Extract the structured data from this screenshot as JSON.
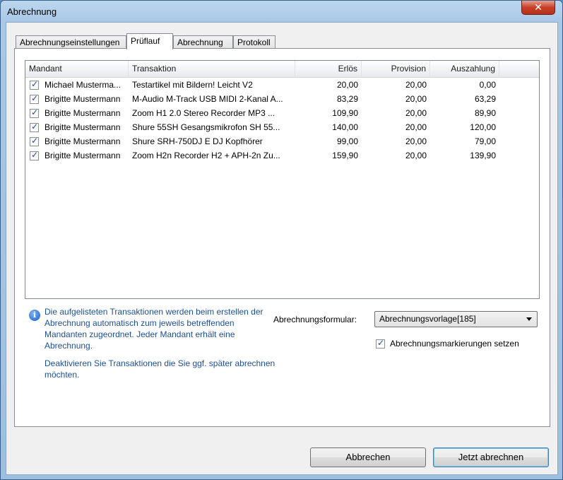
{
  "window": {
    "title": "Abrechnung",
    "close_label": "✕"
  },
  "tabs": [
    {
      "label": "Abrechnungseinstellungen"
    },
    {
      "label": "Prüflauf"
    },
    {
      "label": "Abrechnung"
    },
    {
      "label": "Protokoll"
    }
  ],
  "table": {
    "headers": [
      "Mandant",
      "Transaktion",
      "Erlös",
      "Provision",
      "Auszahlung"
    ],
    "rows": [
      {
        "mandant": "Michael Musterma...",
        "transaktion": "Testartikel mit Bildern! Leicht V2",
        "erloes": "20,00",
        "provision": "20,00",
        "auszahlung": "0,00"
      },
      {
        "mandant": "Brigitte Mustermann",
        "transaktion": "M-Audio M-Track USB MIDI 2-Kanal A...",
        "erloes": "83,29",
        "provision": "20,00",
        "auszahlung": "63,29"
      },
      {
        "mandant": "Brigitte Mustermann",
        "transaktion": "Zoom H1 2.0 Stereo Recorder MP3 ...",
        "erloes": "109,90",
        "provision": "20,00",
        "auszahlung": "89,90"
      },
      {
        "mandant": "Brigitte Mustermann",
        "transaktion": "Shure 55SH Gesangsmikrofon SH 55...",
        "erloes": "140,00",
        "provision": "20,00",
        "auszahlung": "120,00"
      },
      {
        "mandant": "Brigitte Mustermann",
        "transaktion": "Shure SRH-750DJ E DJ Kopfhörer",
        "erloes": "99,00",
        "provision": "20,00",
        "auszahlung": "79,00"
      },
      {
        "mandant": "Brigitte Mustermann",
        "transaktion": "Zoom H2n Recorder H2 + APH-2n Zu...",
        "erloes": "159,90",
        "provision": "20,00",
        "auszahlung": "139,90"
      }
    ]
  },
  "info": {
    "icon": "info-icon",
    "text1": "Die aufgelisteten Transaktionen werden beim erstellen der Abrechnung automatisch zum jeweils betreffenden Mandanten zugeordnet. Jeder Mandant erhält eine Abrechnung.",
    "text2": "Deaktivieren Sie Transaktionen die Sie ggf. später abrechnen möchten."
  },
  "form": {
    "label": "Abrechnungsformular:",
    "selected": "Abrechnungsvorlage[185]",
    "checkbox_label": "Abrechnungsmarkierungen setzen"
  },
  "buttons": {
    "cancel": "Abbrechen",
    "submit": "Jetzt abrechnen"
  }
}
